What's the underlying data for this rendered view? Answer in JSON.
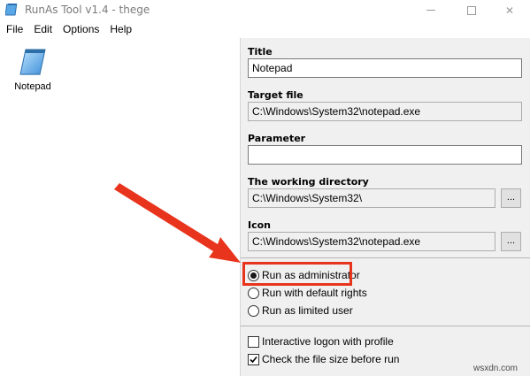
{
  "window": {
    "title": "RunAs Tool v1.4 - thege",
    "minimize_glyph": "—",
    "close_glyph": "✕"
  },
  "menu": {
    "items": [
      "File",
      "Edit",
      "Options",
      "Help"
    ]
  },
  "tools": {
    "items": [
      {
        "label": "Notepad",
        "icon": "notepad-icon"
      }
    ]
  },
  "form": {
    "title": {
      "label": "Title",
      "value": "Notepad"
    },
    "target_file": {
      "label": "Target file",
      "value": "C:\\Windows\\System32\\notepad.exe"
    },
    "parameter": {
      "label": "Parameter",
      "value": ""
    },
    "working_directory": {
      "label": "The working directory",
      "value": "C:\\Windows\\System32\\",
      "browse_label": "..."
    },
    "icon": {
      "label": "Icon",
      "value": "C:\\Windows\\System32\\notepad.exe",
      "browse_label": "..."
    }
  },
  "run_options": {
    "selected": "Run as administrator",
    "items": [
      "Run as administrator",
      "Run with default rights",
      "Run as limited user"
    ]
  },
  "checkboxes": {
    "interactive_logon": {
      "label": "Interactive logon with profile",
      "checked": false
    },
    "check_file_size": {
      "label": "Check the file size before run",
      "checked": true
    }
  },
  "annotation": {
    "color": "#e8341c"
  },
  "watermark": "wsxdn.com",
  "colors": {
    "panel_bg": "#f0f0f0",
    "accent_red": "#e8341c"
  }
}
